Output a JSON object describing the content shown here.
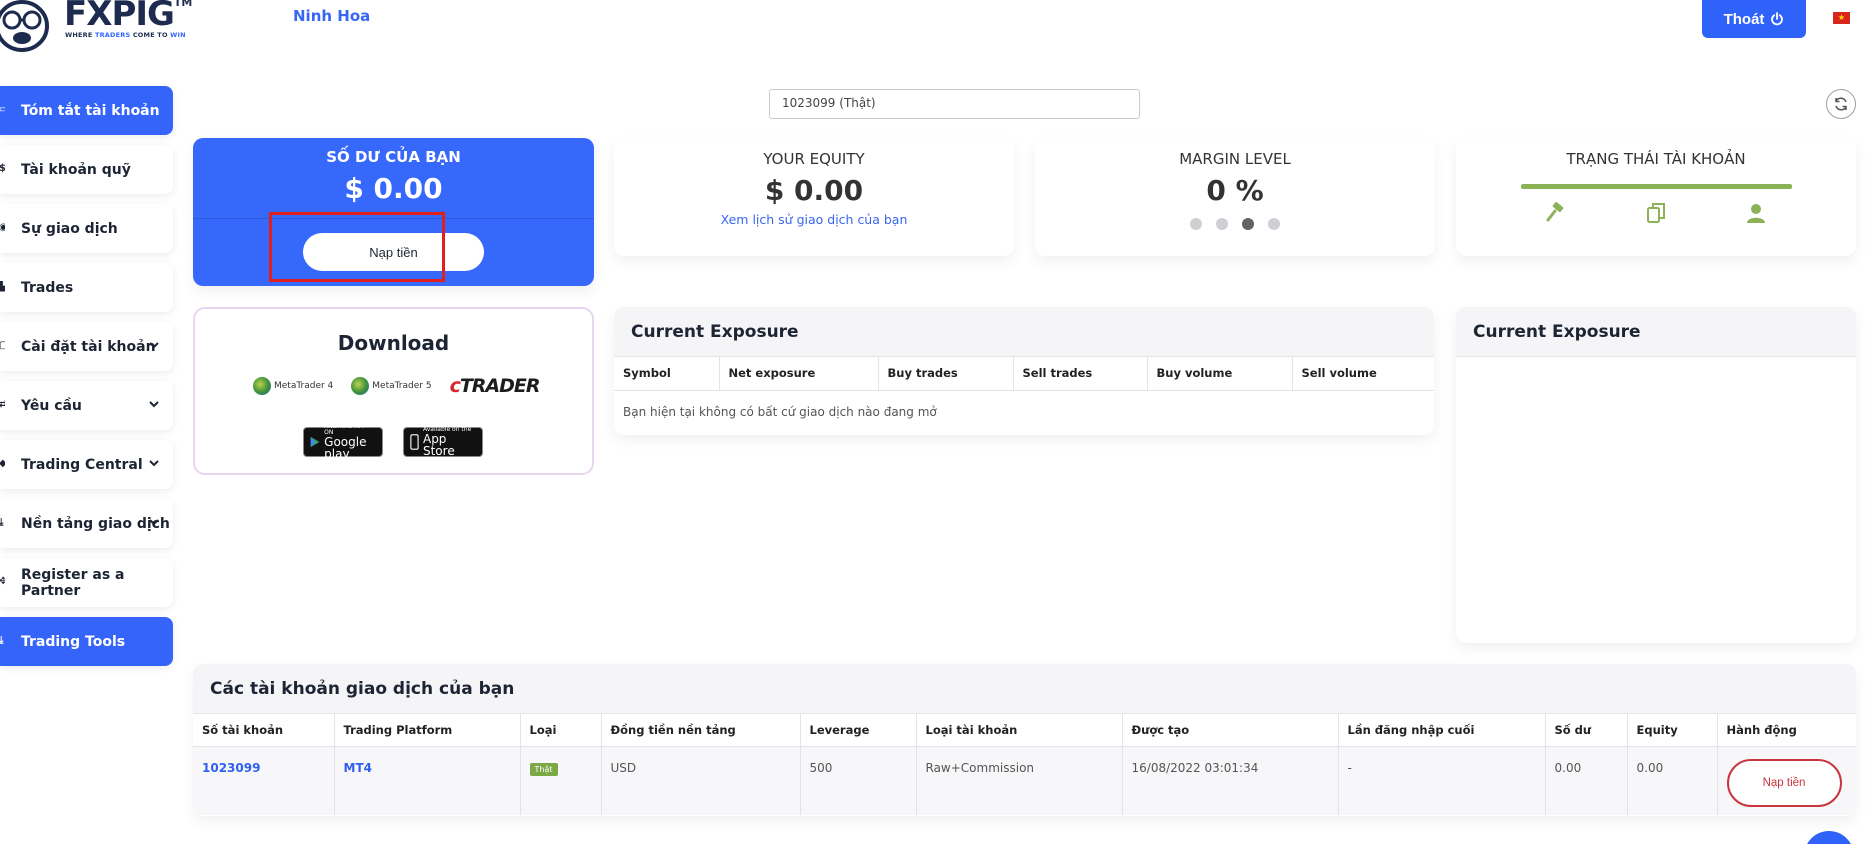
{
  "header": {
    "brand": "FXPIG",
    "brand_tm": "TM",
    "tagline_1": "WHERE ",
    "tagline_2": "TRADERS",
    "tagline_3": " COME TO ",
    "tagline_4": "WIN",
    "user_name": "Ninh Hoa",
    "logout_label": "Thoát",
    "flag_star": "★"
  },
  "sidebar": {
    "items": [
      {
        "label": "Tóm tắt tài khoản",
        "active": true
      },
      {
        "label": "Tài khoản quỹ"
      },
      {
        "label": "Sự giao dịch"
      },
      {
        "label": "Trades"
      },
      {
        "label": "Cài đặt tài khoản",
        "dropdown": true
      },
      {
        "label": "Yêu cầu",
        "dropdown": true
      },
      {
        "label": "Trading Central",
        "dropdown": true
      },
      {
        "label": "Nền tảng giao dịch",
        "dropdown": true
      },
      {
        "label": "Register as a Partner"
      },
      {
        "label": "Trading Tools",
        "active": true
      }
    ]
  },
  "account_select": {
    "value": "1023099 (Thật)"
  },
  "balance": {
    "title": "SỐ DƯ CỦA BẠN",
    "amount": "$ 0.00",
    "deposit_label": "Nạp tiền"
  },
  "equity": {
    "title": "YOUR EQUITY",
    "amount": "$ 0.00",
    "history_link": "Xem lịch sử giao dịch của bạn"
  },
  "margin": {
    "title": "MARGIN LEVEL",
    "value": "0 %",
    "active_dot": 3
  },
  "account_status": {
    "title": "TRẠNG THÁI TÀI KHOẢN",
    "icons": [
      "gavel-icon",
      "copy-icon",
      "user-icon"
    ],
    "accent": "#8bb256"
  },
  "download": {
    "title": "Download",
    "mt4": "MetaTrader 4",
    "mt5": "MetaTrader 5",
    "ctrader_c": "c",
    "ctrader_rest": "TRADER",
    "google_small": "ANDROID APP ON",
    "google_big": "Google play",
    "apple_small": "Available on the",
    "apple_big": "App Store"
  },
  "exposure_main": {
    "title": "Current Exposure",
    "columns": [
      "Symbol",
      "Net exposure",
      "Buy trades",
      "Sell trades",
      "Buy volume",
      "Sell volume"
    ],
    "empty_text": "Bạn hiện tại không có bất cứ giao dịch nào đang mở"
  },
  "exposure_side": {
    "title": "Current Exposure"
  },
  "accounts": {
    "title": "Các tài khoản giao dịch của bạn",
    "columns": [
      "Số tài khoản",
      "Trading Platform",
      "Loại",
      "Đồng tiền nền tảng",
      "Leverage",
      "Loại tài khoản",
      "Được tạo",
      "Lần đăng nhập cuối",
      "Số dư",
      "Equity",
      "Hành động"
    ],
    "rows": [
      {
        "account": "1023099",
        "platform": "MT4",
        "type": "Thật",
        "currency": "USD",
        "leverage": "500",
        "account_type": "Raw+Commission",
        "created": "16/08/2022 03:01:34",
        "last_login": "-",
        "balance": "0.00",
        "equity": "0.00",
        "action": "Nạp tiền"
      }
    ]
  },
  "colors": {
    "primary": "#3564fb",
    "highlight": "#e0201f",
    "status_green": "#8bb256",
    "danger": "#c8353e"
  }
}
